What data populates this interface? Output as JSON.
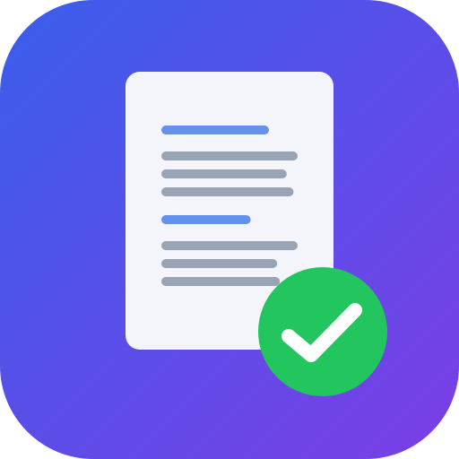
{
  "icon": {
    "name": "document-verified-app-icon",
    "glyphs": [
      "document-icon",
      "checkmark-badge-icon"
    ]
  },
  "colors": {
    "background_start": "#3a5eea",
    "background_end": "#7b3ee6",
    "document_page": "#f4f5fa",
    "heading_line": "#6490ee",
    "text_line": "#98a4b4",
    "badge": "#22c55e",
    "checkmark": "#ffffff"
  },
  "document": {
    "sections": [
      {
        "heading_fraction": 1.0,
        "line_fractions": [
          1.0,
          0.92,
          0.97
        ]
      },
      {
        "heading_fraction": 0.83,
        "line_fractions": [
          1.0,
          0.85,
          0.87
        ]
      }
    ]
  }
}
